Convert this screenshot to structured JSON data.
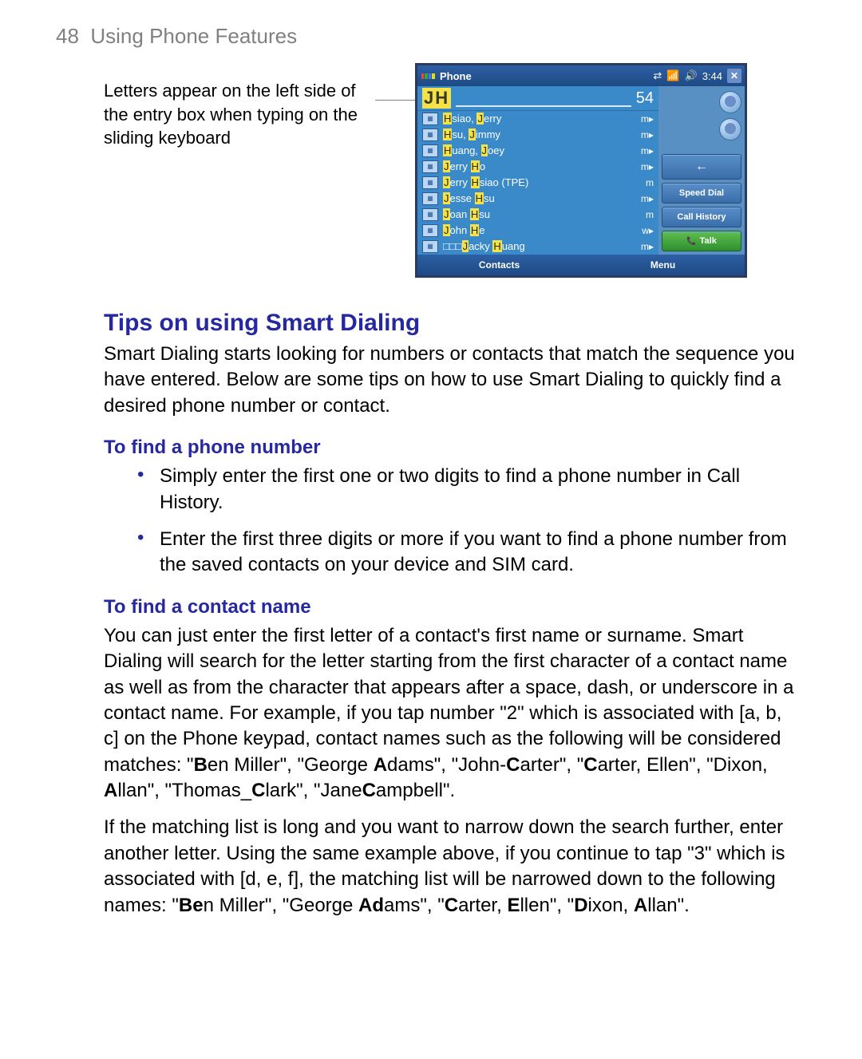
{
  "header": {
    "page_number": "48",
    "chapter": "Using Phone Features"
  },
  "caption": "Letters appear on the left side of the entry box when typing on the sliding keyboard",
  "screenshot": {
    "titlebar": {
      "title": "Phone",
      "time": "3:44"
    },
    "entry": {
      "typed": "JH",
      "count": "54"
    },
    "contacts": [
      {
        "pre": "",
        "hl1": "H",
        "mid1": "siao, ",
        "hl2": "J",
        "mid2": "erry",
        "tag": "m▸"
      },
      {
        "pre": "",
        "hl1": "H",
        "mid1": "su, ",
        "hl2": "J",
        "mid2": "immy",
        "tag": "m▸"
      },
      {
        "pre": "",
        "hl1": "H",
        "mid1": "uang, ",
        "hl2": "J",
        "mid2": "oey",
        "tag": "m▸"
      },
      {
        "pre": "",
        "hl1": "J",
        "mid1": "erry ",
        "hl2": "H",
        "mid2": "o",
        "tag": "m▸"
      },
      {
        "pre": "",
        "hl1": "J",
        "mid1": "erry ",
        "hl2": "H",
        "mid2": "siao (TPE)",
        "tag": "m"
      },
      {
        "pre": "",
        "hl1": "J",
        "mid1": "esse ",
        "hl2": "H",
        "mid2": "su",
        "tag": "m▸"
      },
      {
        "pre": "",
        "hl1": "J",
        "mid1": "oan ",
        "hl2": "H",
        "mid2": "su",
        "tag": "m"
      },
      {
        "pre": "",
        "hl1": "J",
        "mid1": "ohn ",
        "hl2": "H",
        "mid2": "e",
        "tag": "w▸"
      },
      {
        "pre": "□□□",
        "hl1": "J",
        "mid1": "acky ",
        "hl2": "H",
        "mid2": "uang",
        "tag": "m▸"
      }
    ],
    "sidebar": {
      "speed_dial": "Speed Dial",
      "call_history": "Call History",
      "talk": "Talk"
    },
    "menubar": {
      "left": "Contacts",
      "right": "Menu"
    }
  },
  "section_heading": "Tips on using Smart Dialing",
  "intro_para": "Smart Dialing starts looking for numbers or contacts that match the sequence you have entered. Below are some tips on how to use Smart Dialing to quickly find a desired phone number or contact.",
  "sub1_heading": "To find a phone number",
  "sub1_bullets": [
    "Simply enter the first one or two digits to find a phone number in Call History.",
    "Enter the first three digits or more if you want to find a phone number from the saved contacts on your device and SIM card."
  ],
  "sub2_heading": "To find a contact name",
  "sub2_para1_parts": {
    "t0": "You can just enter the first letter of a contact's first name or surname. Smart Dialing will search for the letter starting from the first character of a contact name as well as from the character that appears after a space, dash, or underscore in a contact name. For example, if you tap number \"2\" which is associated with [a, b, c] on the Phone keypad, contact names such as the following will be considered matches: \"",
    "b0": "B",
    "t1": "en Miller\", \"George ",
    "b1": "A",
    "t2": "dams\", \"John-",
    "b2": "C",
    "t3": "arter\", \"",
    "b3": "C",
    "t4": "arter, Ellen\", \"Dixon, ",
    "b4": "A",
    "t5": "llan\", \"Thomas_",
    "b5": "C",
    "t6": "lark\", \"Jane",
    "b6": "C",
    "t7": "ampbell\"."
  },
  "sub2_para2_parts": {
    "t0": "If the matching list is long and you want to narrow down the search further, enter another letter. Using the same example above, if you continue to tap \"3\" which is associated with [d, e, f], the matching list will be narrowed down to the following names: \"",
    "b0": "Be",
    "t1": "n Miller\", \"George ",
    "b1": "Ad",
    "t2": "ams\", \"",
    "b2": "C",
    "t3": "arter, ",
    "b3": "E",
    "t4": "llen\", \"",
    "b4": "D",
    "t5": "ixon, ",
    "b5": "A",
    "t6": "llan\"."
  }
}
